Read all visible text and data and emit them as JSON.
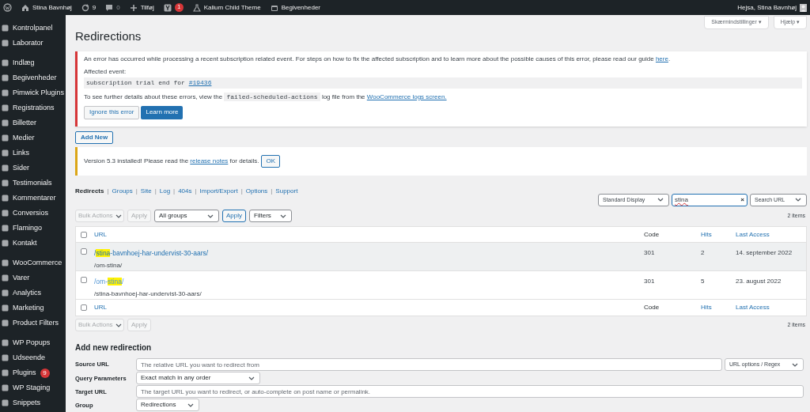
{
  "admin_bar": {
    "site": "Stina Bavnhøj",
    "updates": "9",
    "comments": "0",
    "new": "Tilføj",
    "seo_badge": "1",
    "theme": "Kalium Child Theme",
    "events": "Begivenheder",
    "greeting": "Hejsa, Stina Bavnhøj"
  },
  "sidebar": {
    "groups": [
      [
        {
          "label": "Kontrolpanel"
        },
        {
          "label": "Laborator"
        }
      ],
      [
        {
          "label": "Indlæg"
        },
        {
          "label": "Begivenheder"
        },
        {
          "label": "Pimwick Plugins"
        },
        {
          "label": "Registrations"
        },
        {
          "label": "Billetter"
        },
        {
          "label": "Medier"
        },
        {
          "label": "Links"
        },
        {
          "label": "Sider"
        },
        {
          "label": "Testimonials"
        },
        {
          "label": "Kommentarer"
        },
        {
          "label": "Conversios"
        },
        {
          "label": "Flamingo"
        },
        {
          "label": "Kontakt"
        }
      ],
      [
        {
          "label": "WooCommerce"
        },
        {
          "label": "Varer"
        },
        {
          "label": "Analytics"
        },
        {
          "label": "Marketing"
        },
        {
          "label": "Product Filters"
        }
      ],
      [
        {
          "label": "WP Popups"
        },
        {
          "label": "Udseende"
        },
        {
          "label": "Plugins",
          "badge": "9"
        },
        {
          "label": "WP Staging"
        },
        {
          "label": "Snippets"
        }
      ]
    ]
  },
  "screen_buttons": [
    "Skærmindstillinger ▾",
    "Hjælp ▾"
  ],
  "title": "Redirections",
  "error_notice": {
    "line_1": [
      {
        "kind": "text",
        "text": "An error has occurred while processing a recent subscription related event. For steps on how to fix the affected subscription and to learn more about the possible causes of this error, please read our guide "
      },
      {
        "kind": "link",
        "text": "here"
      },
      {
        "kind": "text",
        "text": "."
      }
    ],
    "affected_label": "Affected event:",
    "event": [
      {
        "kind": "text",
        "text": "subscription trial end for "
      },
      {
        "kind": "link",
        "text": "#19436"
      }
    ],
    "line_2": [
      {
        "kind": "text",
        "text": "To see further details about these errors, view the "
      },
      {
        "kind": "code",
        "text": "failed-scheduled-actions"
      },
      {
        "kind": "text",
        "text": " log file from the "
      },
      {
        "kind": "link",
        "text": "WooCommerce logs screen."
      }
    ],
    "buttons": [
      {
        "label": "Ignore this error",
        "primary": false
      },
      {
        "label": "Learn more",
        "primary": true
      }
    ]
  },
  "add_new": "Add New",
  "version_notice": {
    "text": [
      {
        "kind": "text",
        "text": "Version 5.3 installed! Please read the "
      },
      {
        "kind": "link",
        "text": "release notes"
      },
      {
        "kind": "text",
        "text": " for details."
      }
    ],
    "button": "OK"
  },
  "subnav": [
    {
      "label": "Redirects",
      "selected": true
    },
    {
      "separator": "|",
      "label": "Groups",
      "selected": false
    },
    {
      "separator": "|",
      "label": "Site",
      "selected": false
    },
    {
      "separator": "|",
      "label": "Log",
      "selected": false
    },
    {
      "separator": "|",
      "label": "404s",
      "selected": false
    },
    {
      "separator": "|",
      "label": "Import/Export",
      "selected": false
    },
    {
      "separator": "|",
      "label": "Options",
      "selected": false
    },
    {
      "separator": "|",
      "label": "Support",
      "selected": false
    }
  ],
  "display_select": "Standard Display",
  "search": {
    "value": "stina",
    "clear": "×"
  },
  "search_select": "Search URL",
  "top_actions": {
    "bulk": "Bulk Actions",
    "apply": "Apply",
    "group_select": "All groups",
    "apply_2": "Apply",
    "filters": "Filters",
    "count": "2 items"
  },
  "table": {
    "columns": [
      "URL",
      "Code",
      "Hits",
      "Last Access"
    ],
    "header_checked": false,
    "footer_columns": [
      "URL",
      "Code",
      "Hits",
      "Last Access"
    ],
    "footer_checked": false,
    "rows": [
      {
        "source": [
          {
            "kind": "text",
            "text": "/"
          },
          {
            "kind": "match",
            "text": "stina"
          },
          {
            "kind": "text",
            "text": "-bavnhoej-har-undervist-30-aars/"
          }
        ],
        "target": "/om-stina/",
        "code": "301",
        "hits": "2",
        "last_access": "14. september 2022",
        "disabled": false,
        "hover": true,
        "checked": false
      },
      {
        "source": [
          {
            "kind": "text",
            "text": "/om-"
          },
          {
            "kind": "match",
            "text": "stina"
          },
          {
            "kind": "text",
            "text": "/"
          }
        ],
        "target": "/stina-bavnhoej-har-undervist-30-aars/",
        "code": "301",
        "hits": "5",
        "last_access": "23. august 2022",
        "disabled": true,
        "hover": false,
        "checked": false
      }
    ]
  },
  "bottom_actions": {
    "bulk": "Bulk Actions",
    "apply": "Apply",
    "count": "2 items"
  },
  "add_form": {
    "title": "Add new redirection",
    "rows": [
      {
        "kind": "input",
        "label": "Source URL",
        "placeholder": "The relative URL you want to redirect from",
        "extra": "URL options / Regex"
      },
      {
        "kind": "select",
        "label": "Query Parameters",
        "value": "Exact match in any order"
      },
      {
        "kind": "input",
        "label": "Target URL",
        "placeholder": "The target URL you want to redirect, or auto-complete on post name or permalink."
      },
      {
        "kind": "select",
        "label": "Group",
        "value": "Redirections"
      }
    ]
  }
}
